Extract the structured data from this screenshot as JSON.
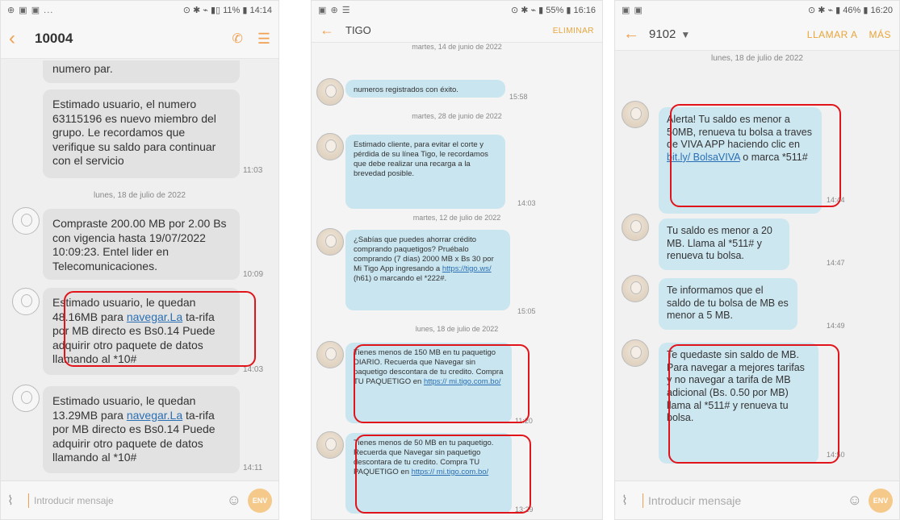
{
  "phones": [
    {
      "status": {
        "left": "⊕ ▣ ▣ ...",
        "right": "⊙ ✱ ⌁ ▮▯ 11% ▮ 14:14"
      },
      "contact": "10004",
      "messages": [
        {
          "text": "numero par."
        },
        {
          "text": "Estimado usuario, el numero 63115196 es nuevo miembro del grupo. Le recordamos que verifique su saldo para continuar con el servicio",
          "time": "11:03"
        },
        {
          "date": "lunes, 18 de julio de 2022"
        },
        {
          "text": "Compraste 200.00 MB por 2.00 Bs con vigencia hasta 19/07/2022 10:09:23. Entel lider en Telecomunicaciones.",
          "time": "10:09"
        },
        {
          "text_before": "Estimado usuario, le quedan 48.16MB para ",
          "link": "navegar.La",
          "text_after": " ta-rifa por MB directo es Bs0.14 Puede adquirir otro paquete de datos llamando al *10#",
          "time": "14:03"
        },
        {
          "text_before": "Estimado usuario, le quedan 13.29MB para ",
          "link": "navegar.La",
          "text_after": " ta-rifa por MB directo es Bs0.14 Puede adquirir otro paquete de datos llamando al *10#",
          "time": "14:11"
        }
      ],
      "composer": {
        "placeholder": "Introducir mensaje",
        "send": "ENV"
      }
    },
    {
      "status": {
        "left": "▣ ⊕ ☰",
        "right": "⊙ ✱ ⌁ ▮ 55% ▮ 16:16"
      },
      "contact": "TIGO",
      "action": "ELIMINAR",
      "messages": [
        {
          "date": "martes, 14 de junio de 2022"
        },
        {
          "text": "numeros registrados con éxito.",
          "time": "15:58"
        },
        {
          "date": "martes, 28 de junio de 2022"
        },
        {
          "text": "Estimado cliente, para evitar el corte y pérdida de su línea Tigo, le recordamos que debe realizar una recarga a la brevedad posible.",
          "time": "14:03"
        },
        {
          "date": "martes, 12 de julio de 2022"
        },
        {
          "text_before": "¿Sabías que puedes ahorrar crédito comprando paquetigos? Pruébalo comprando (7 días) 2000 MB x Bs 30 por Mi Tigo App ingresando a ",
          "link": "https://tigo.ws/",
          "text_after": " (h61) o marcando el *222#.",
          "time": "15:05"
        },
        {
          "date": "lunes, 18 de julio de 2022"
        },
        {
          "text_before": "Tienes menos de 150 MB en tu paquetigo DIARIO. Recuerda que Navegar sin paquetigo descontara de tu credito. Compra TU PAQUETIGO en ",
          "link": "https:// mi.tigo.com.bo/",
          "text_after": "",
          "time": "11:20"
        },
        {
          "text_before": "Tienes menos de 50 MB en tu paquetigo. Recuerda que Navegar sin paquetigo descontara de tu credito. Compra TU PAQUETIGO en ",
          "link": "https:// mi.tigo.com.bo/",
          "text_after": "",
          "time": "13:29"
        }
      ]
    },
    {
      "status": {
        "left": "▣ ▣",
        "right": "⊙ ✱ ⌁ ▮ 46% ▮ 16:20"
      },
      "contact": "9102",
      "action1": "LLAMAR A",
      "action2": "MÁS",
      "messages": [
        {
          "date": "lunes, 18 de julio de 2022"
        },
        {
          "text_before": "Alerta! Tu saldo es menor a 50MB, renueva tu bolsa a traves de VIVA APP haciendo clic en ",
          "link": "bit.ly/ BolsaVIVA",
          "text_after": " o marca *511#",
          "time": "14:44"
        },
        {
          "text": "Tu saldo es menor a 20 MB. Llama al *511# y renueva tu bolsa.",
          "time": "14:47"
        },
        {
          "text": "Te informamos que el saldo de tu bolsa de MB es menor a 5 MB.",
          "time": "14:49"
        },
        {
          "text": "Te quedaste sin saldo de MB. Para navegar a mejores tarifas y no navegar a tarifa de MB adicional (Bs. 0.50 por MB) llama al *511# y renueva tu bolsa.",
          "time": "14:50"
        }
      ],
      "composer": {
        "placeholder": "Introducir mensaje",
        "send": "ENV"
      }
    }
  ],
  "colors": {
    "highlight": "#e0141a",
    "accent": "#f0a050",
    "bubble_blue": "#c9e5ef",
    "bubble_gray": "#e2e2e2",
    "link": "#2a6fb3"
  },
  "icons": [
    "back-arrow-icon",
    "phone-icon",
    "menu-icon",
    "caret-down-icon",
    "attach-icon",
    "smiley-icon",
    "avatar-icon"
  ]
}
